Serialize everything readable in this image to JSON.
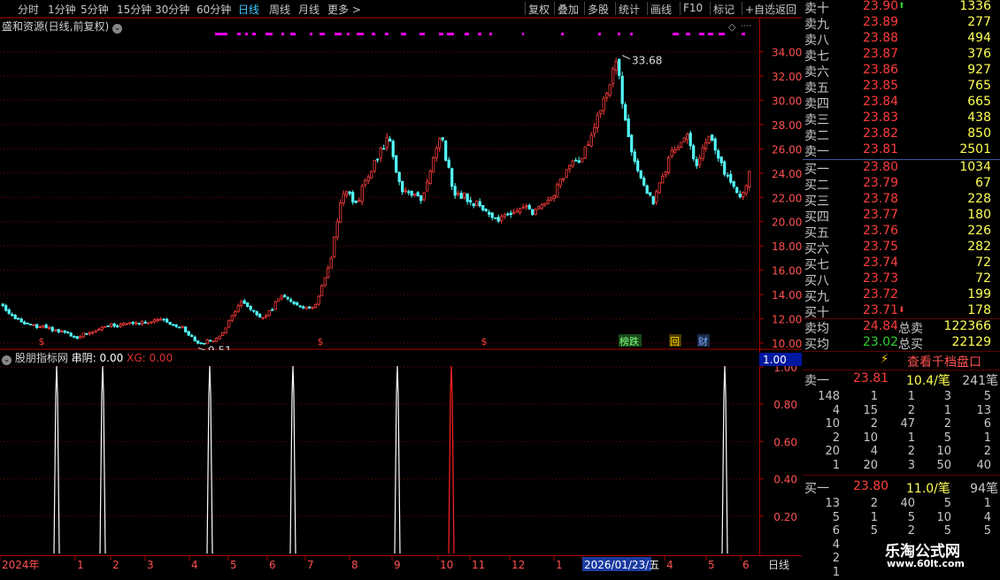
{
  "toolbar": {
    "left_items": [
      "分时",
      "1分钟",
      "5分钟",
      "15分钟",
      "30分钟",
      "60分钟",
      "日线",
      "周线",
      "月线",
      "更多 >"
    ],
    "active": "日线",
    "right_items": [
      "复权",
      "叠加",
      "多股",
      "统计",
      "画线",
      "F10",
      "标记",
      "+自选",
      "返回"
    ]
  },
  "chart": {
    "title": "盛和资源(日线,前复权)",
    "high_label": "33.68",
    "low_label": "9.51",
    "y_ticks": [
      "34.00",
      "32.00",
      "30.00",
      "28.00",
      "26.00",
      "24.00",
      "22.00",
      "20.00",
      "18.00",
      "16.00",
      "14.00",
      "12.00",
      "10.00"
    ],
    "markers": [
      "$",
      "$",
      "$"
    ],
    "event_tags": [
      "榜跌",
      "回",
      "财"
    ]
  },
  "indicator": {
    "name": "股朋指标网",
    "label": "串阴:",
    "value": "0.00",
    "xg_label": "XG:",
    "xg_value": "0.00",
    "top_badge": "1.00",
    "y_ticks": [
      "1.00",
      "0.80",
      "0.60",
      "0.40",
      "0.20"
    ]
  },
  "xaxis": {
    "labels": [
      "2024年",
      "1",
      "2",
      "3",
      "4",
      "5",
      "6",
      "7",
      "8",
      "9",
      "10",
      "11",
      "12",
      "1",
      "2026/01/23/五",
      "4",
      "5",
      "6"
    ],
    "period": "日线"
  },
  "orderbook": {
    "asks": [
      {
        "label": "卖十",
        "price": "23.90",
        "vol": "1336"
      },
      {
        "label": "卖九",
        "price": "23.89",
        "vol": "277"
      },
      {
        "label": "卖八",
        "price": "23.88",
        "vol": "494"
      },
      {
        "label": "卖七",
        "price": "23.87",
        "vol": "376"
      },
      {
        "label": "卖六",
        "price": "23.86",
        "vol": "927"
      },
      {
        "label": "卖五",
        "price": "23.85",
        "vol": "765"
      },
      {
        "label": "卖四",
        "price": "23.84",
        "vol": "665"
      },
      {
        "label": "卖三",
        "price": "23.83",
        "vol": "438"
      },
      {
        "label": "卖二",
        "price": "23.82",
        "vol": "850"
      },
      {
        "label": "卖一",
        "price": "23.81",
        "vol": "2501"
      }
    ],
    "bids": [
      {
        "label": "买一",
        "price": "23.80",
        "vol": "1034"
      },
      {
        "label": "买二",
        "price": "23.79",
        "vol": "67"
      },
      {
        "label": "买三",
        "price": "23.78",
        "vol": "228"
      },
      {
        "label": "买四",
        "price": "23.77",
        "vol": "180"
      },
      {
        "label": "买五",
        "price": "23.76",
        "vol": "226"
      },
      {
        "label": "买六",
        "price": "23.75",
        "vol": "282"
      },
      {
        "label": "买七",
        "price": "23.74",
        "vol": "72"
      },
      {
        "label": "买八",
        "price": "23.73",
        "vol": "72"
      },
      {
        "label": "买九",
        "price": "23.72",
        "vol": "199"
      },
      {
        "label": "买十",
        "price": "23.71",
        "vol": "178"
      }
    ],
    "avg_sell_label": "卖均",
    "avg_sell": "24.84",
    "total_sell_label": "总卖",
    "total_sell": "122366",
    "avg_buy_label": "买均",
    "avg_buy": "23.02",
    "total_buy_label": "总买",
    "total_buy": "22129",
    "depth_button": "查看千档盘口",
    "sell1": {
      "label": "卖一",
      "price": "23.81",
      "per": "10.4/笔",
      "count": "241笔"
    },
    "sell1_queue": [
      [
        "148",
        "1",
        "1",
        "3",
        "5"
      ],
      [
        "4",
        "15",
        "2",
        "1",
        "13"
      ],
      [
        "10",
        "2",
        "47",
        "2",
        "6"
      ],
      [
        "2",
        "10",
        "1",
        "5",
        "1"
      ],
      [
        "20",
        "4",
        "2",
        "10",
        "2"
      ],
      [
        "1",
        "20",
        "3",
        "50",
        "40"
      ]
    ],
    "buy1": {
      "label": "买一",
      "price": "23.80",
      "per": "11.0/笔",
      "count": "94笔"
    },
    "buy1_queue": [
      [
        "13",
        "2",
        "40",
        "5",
        "1"
      ],
      [
        "5",
        "1",
        "5",
        "10",
        "4"
      ],
      [
        "6",
        "5",
        "2",
        "5",
        "5"
      ],
      [
        "4",
        "",
        "",
        "",
        ""
      ],
      [
        "2",
        "",
        "",
        "",
        ""
      ],
      [
        "1",
        "",
        "",
        "",
        ""
      ]
    ],
    "watermark_title": "乐淘公式网",
    "watermark_url": "www.60lt.com"
  },
  "colors": {
    "up": "#ff3c3c",
    "down": "#54ffff",
    "grid": "#780000",
    "magenta": "#ff00ff"
  }
}
